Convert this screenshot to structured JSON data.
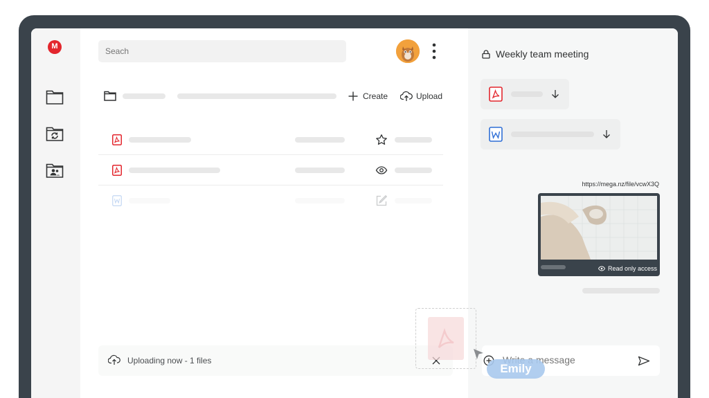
{
  "app": {
    "logo_letter": "M",
    "brand_color": "#e3262d"
  },
  "sidebar": {
    "items": [
      {
        "icon": "folder-icon"
      },
      {
        "icon": "sync-folder-icon"
      },
      {
        "icon": "shared-folder-icon"
      }
    ]
  },
  "search": {
    "placeholder": "Seach"
  },
  "toolbar": {
    "create_label": "Create",
    "upload_label": "Upload"
  },
  "files": [
    {
      "type": "pdf",
      "action_icon": "star-icon"
    },
    {
      "type": "pdf",
      "action_icon": "eye-icon"
    },
    {
      "type": "word",
      "action_icon": "edit-icon"
    }
  ],
  "upload_status": {
    "text": "Uploading now - 1 files"
  },
  "chat": {
    "title": "Weekly team meeting",
    "attachments": [
      {
        "type": "pdf",
        "icon": "download-icon"
      },
      {
        "type": "word",
        "icon": "download-icon"
      }
    ],
    "link": "https://mega.nz/file/vcwX3Q",
    "preview_access": "Read only access",
    "message_placeholder": "Write a message"
  },
  "drag": {
    "user_name": "Emily"
  }
}
